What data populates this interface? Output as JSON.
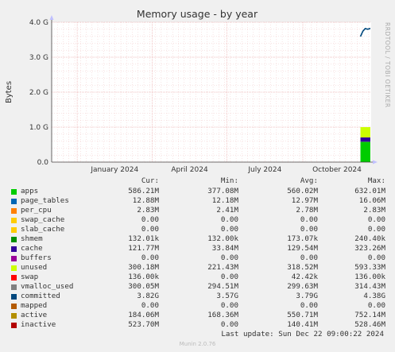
{
  "chart_data": {
    "type": "area",
    "title": "Memory usage - by year",
    "ylabel": "Bytes",
    "y_ticks": [
      {
        "value": 0,
        "label": "0.0"
      },
      {
        "value": 1073741824,
        "label": "1.0 G"
      },
      {
        "value": 2147483648,
        "label": "2.0 G"
      },
      {
        "value": 3221225472,
        "label": "3.0 G"
      },
      {
        "value": 4294967296,
        "label": "4.0 G"
      }
    ],
    "ylim": [
      0,
      4294967296
    ],
    "x_ticks": [
      "January 2024",
      "April 2024",
      "July 2024",
      "October 2024"
    ],
    "x_tick_dates": [
      "2024-01-01",
      "2024-04-01",
      "2024-07-01",
      "2024-10-01"
    ],
    "xlim": [
      "2023-12-01",
      "2024-12-23"
    ],
    "grid": true,
    "data_start": "2024-12-10",
    "series_order_note": "stacked areas from apps upward; committed drawn as line",
    "series": [
      {
        "name": "apps",
        "color": "#00cc00",
        "cur": 614680576
      },
      {
        "name": "page_tables",
        "color": "#0066b3",
        "cur": 13507461
      },
      {
        "name": "per_cpu",
        "color": "#ff8000",
        "cur": 2967470
      },
      {
        "name": "shmem",
        "color": "#008f00",
        "cur": 135178
      },
      {
        "name": "cache",
        "color": "#330099",
        "cur": 127686656
      },
      {
        "name": "unused",
        "color": "#ccff00",
        "cur": 314761216
      },
      {
        "name": "committed",
        "color": "#00487d",
        "cur": 4101723586
      }
    ]
  },
  "side_text": "RRDTOOL / TOBI OETIKER",
  "legend": {
    "headers": {
      "cur": "Cur:",
      "min": "Min:",
      "avg": "Avg:",
      "max": "Max:"
    },
    "rows": [
      {
        "name": "apps",
        "color": "#00cc00",
        "cur": "586.21M",
        "min": "377.08M",
        "avg": "560.02M",
        "max": "632.01M"
      },
      {
        "name": "page_tables",
        "color": "#0066b3",
        "cur": "12.88M",
        "min": "12.18M",
        "avg": "12.97M",
        "max": "16.06M"
      },
      {
        "name": "per_cpu",
        "color": "#ff8000",
        "cur": "2.83M",
        "min": "2.41M",
        "avg": "2.78M",
        "max": "2.83M"
      },
      {
        "name": "swap_cache",
        "color": "#ffcc00",
        "cur": "0.00",
        "min": "0.00",
        "avg": "0.00",
        "max": "0.00"
      },
      {
        "name": "slab_cache",
        "color": "#ffcc00",
        "cur": "0.00",
        "min": "0.00",
        "avg": "0.00",
        "max": "0.00"
      },
      {
        "name": "shmem",
        "color": "#008f00",
        "cur": "132.01k",
        "min": "132.00k",
        "avg": "173.07k",
        "max": "240.40k"
      },
      {
        "name": "cache",
        "color": "#330099",
        "cur": "121.77M",
        "min": "33.84M",
        "avg": "129.54M",
        "max": "323.26M"
      },
      {
        "name": "buffers",
        "color": "#990099",
        "cur": "0.00",
        "min": "0.00",
        "avg": "0.00",
        "max": "0.00"
      },
      {
        "name": "unused",
        "color": "#ccff00",
        "cur": "300.18M",
        "min": "221.43M",
        "avg": "318.52M",
        "max": "593.33M"
      },
      {
        "name": "swap",
        "color": "#ff0000",
        "cur": "136.00k",
        "min": "0.00",
        "avg": "42.42k",
        "max": "136.00k"
      },
      {
        "name": "vmalloc_used",
        "color": "#808080",
        "cur": "300.05M",
        "min": "294.51M",
        "avg": "299.63M",
        "max": "314.43M"
      },
      {
        "name": "committed",
        "color": "#00487d",
        "cur": "3.82G",
        "min": "3.57G",
        "avg": "3.79G",
        "max": "4.38G"
      },
      {
        "name": "mapped",
        "color": "#b35a00",
        "cur": "0.00",
        "min": "0.00",
        "avg": "0.00",
        "max": "0.00"
      },
      {
        "name": "active",
        "color": "#b38f00",
        "cur": "184.06M",
        "min": "168.36M",
        "avg": "550.71M",
        "max": "752.14M"
      },
      {
        "name": "inactive",
        "color": "#b30000",
        "cur": "523.70M",
        "min": "0.00",
        "avg": "140.41M",
        "max": "528.46M"
      }
    ]
  },
  "footer": "Last update: Sun Dec 22 09:00:22 2024",
  "munin_version": "Munin 2.0.76"
}
